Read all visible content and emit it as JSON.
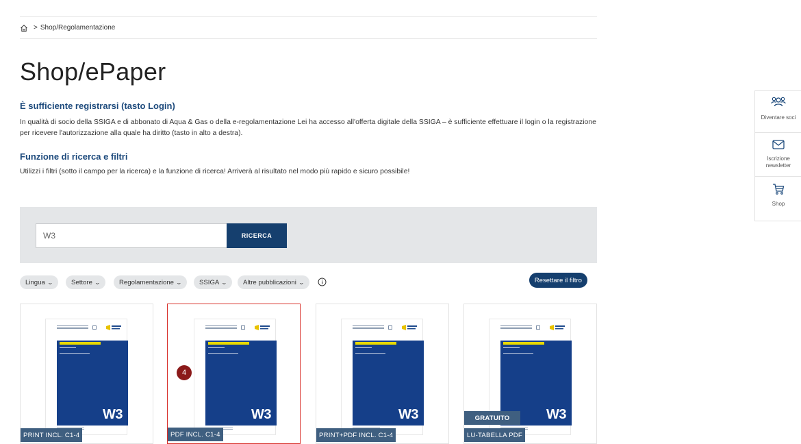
{
  "breadcrumb": {
    "path": "Shop/Regolamentazione"
  },
  "page": {
    "title": "Shop/ePaper"
  },
  "sections": [
    {
      "title": "È sufficiente registrarsi (tasto Login)",
      "text": "In qualità di socio della SSIGA e di abbonato di Aqua & Gas o della e-regolamentazione Lei ha accesso all'offerta digitale della SSIGA – è sufficiente effettuare il login o la registrazione per ricevere l'autorizzazione alla quale ha diritto (tasto in alto a destra)."
    },
    {
      "title": "Funzione di ricerca e filtri",
      "text": "Utilizzi i filtri (sotto il campo per la ricerca) e la funzione di ricerca! Arriverà al risultato nel modo più rapido e sicuro possibile!"
    }
  ],
  "search": {
    "value": "W3",
    "button_label": "RICERCA"
  },
  "filters": [
    {
      "label": "Lingua"
    },
    {
      "label": "Settore"
    },
    {
      "label": "Regolamentazione"
    },
    {
      "label": "SSIGA"
    },
    {
      "label": "Altre pubblicazioni"
    }
  ],
  "reset_label": "Resettare il filtro",
  "products": [
    {
      "cover_code": "W3",
      "badge": "PRINT INCL. C1-4"
    },
    {
      "cover_code": "W3",
      "badge": "PDF INCL. C1-4",
      "marker": "4"
    },
    {
      "cover_code": "W3",
      "badge": "PRINT+PDF INCL. C1-4"
    },
    {
      "cover_code": "W3",
      "badge": "LU-TABELLA PDF",
      "top_badge": "GRATUITO"
    }
  ],
  "side_panel": [
    {
      "icon": "users-icon",
      "label": "Diventare soci"
    },
    {
      "icon": "mail-icon",
      "label": "Iscrizione newsletter"
    },
    {
      "icon": "cart-icon",
      "label": "Shop"
    }
  ],
  "colors": {
    "brand_blue": "#153f6e",
    "heading_blue": "#1d4a7c",
    "cover_blue": "#153f89",
    "badge_bg": "#3f5f80",
    "selection_red": "#d8312b"
  }
}
